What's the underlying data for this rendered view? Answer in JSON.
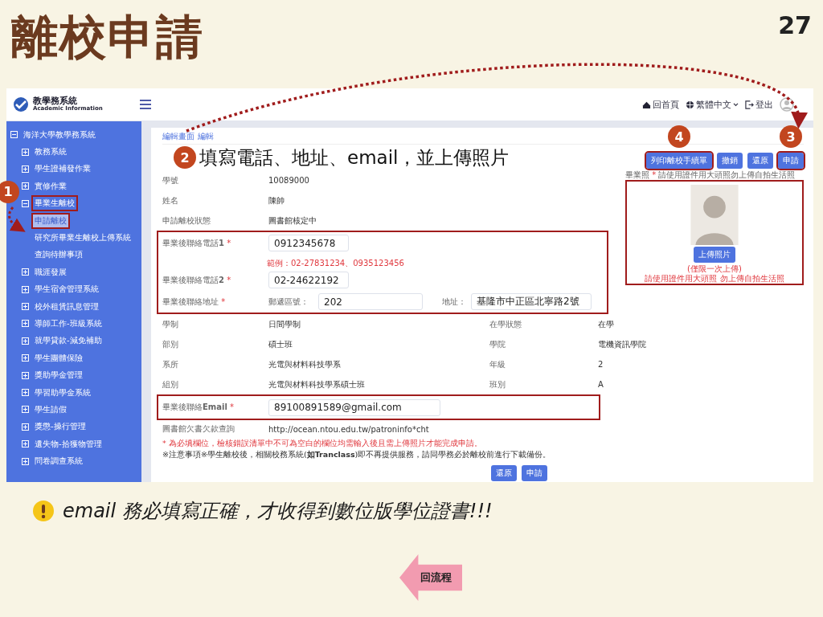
{
  "slide": {
    "title": "離校申請",
    "page_number": "27",
    "note": "email 務必填寫正確，才收得到數位版學位證書!!!",
    "back_button": "回流程"
  },
  "header": {
    "logo_title": "教學務系統",
    "logo_subtitle": "Academic Information",
    "links": [
      {
        "kind": "home",
        "label": "回首頁"
      },
      {
        "kind": "language",
        "label": "繁體中文"
      },
      {
        "kind": "logout",
        "label": "登出"
      }
    ]
  },
  "sidebar": {
    "items": [
      {
        "label": "海洋大學教學務系統",
        "expanded": true,
        "selected": false,
        "highlighted": false,
        "children": [
          {
            "label": "教務系統",
            "expanded": false,
            "selected": false,
            "highlighted": false
          },
          {
            "label": "學生證補發作業",
            "expanded": false,
            "selected": false,
            "highlighted": false
          },
          {
            "label": "實修作業",
            "expanded": false,
            "selected": false,
            "highlighted": false
          },
          {
            "label": "畢業生離校",
            "expanded": true,
            "selected": false,
            "highlighted": true,
            "step": "1",
            "children": [
              {
                "label": "申請離校",
                "selected": true,
                "highlighted": true
              },
              {
                "label": "研究所畢業生離校上傳系統",
                "selected": false,
                "highlighted": false
              },
              {
                "label": "查詢待辦事項",
                "selected": false,
                "highlighted": false
              }
            ]
          },
          {
            "label": "職涯發展",
            "expanded": false,
            "selected": false,
            "highlighted": false
          },
          {
            "label": "學生宿舍管理系統",
            "expanded": false,
            "selected": false,
            "highlighted": false
          },
          {
            "label": "校外租賃訊息管理",
            "expanded": false,
            "selected": false,
            "highlighted": false
          },
          {
            "label": "導師工作-班級系統",
            "expanded": false,
            "selected": false,
            "highlighted": false
          },
          {
            "label": "就學貸款-減免補助",
            "expanded": false,
            "selected": false,
            "highlighted": false
          },
          {
            "label": "學生團體保險",
            "expanded": false,
            "selected": false,
            "highlighted": false
          },
          {
            "label": "獎助學金管理",
            "expanded": false,
            "selected": false,
            "highlighted": false
          },
          {
            "label": "學習助學金系統",
            "expanded": false,
            "selected": false,
            "highlighted": false
          },
          {
            "label": "學生請假",
            "expanded": false,
            "selected": false,
            "highlighted": false
          },
          {
            "label": "獎懲-操行管理",
            "expanded": false,
            "selected": false,
            "highlighted": false
          },
          {
            "label": "遺失物-拾獲物管理",
            "expanded": false,
            "selected": false,
            "highlighted": false
          },
          {
            "label": "問卷調查系統",
            "expanded": false,
            "selected": false,
            "highlighted": false
          }
        ]
      }
    ]
  },
  "form": {
    "breadcrumb": [
      {
        "label": "編輯畫面"
      },
      {
        "label": "編輯"
      }
    ],
    "instruction": {
      "step": "2",
      "text": "填寫電話、地址、email，並上傳照片"
    },
    "actions": [
      {
        "label": "列印離校手續單",
        "highlighted": true,
        "step": "4"
      },
      {
        "label": "撤銷",
        "highlighted": false
      },
      {
        "label": "還原",
        "highlighted": false
      },
      {
        "label": "申請",
        "highlighted": true,
        "step": "3"
      }
    ],
    "info_rows": [
      {
        "label": "學號",
        "value": "10089000"
      },
      {
        "label": "姓名",
        "value": "陳帥"
      },
      {
        "label": "申請離校狀態",
        "value": "圖書館核定中"
      }
    ],
    "contact": {
      "highlighted": true,
      "fields": [
        {
          "kind": "input",
          "label": "畢業後聯絡電話**1**",
          "required_mark": "*",
          "value": "0912345678",
          "hint": "範例：02-27831234、0935123456"
        },
        {
          "kind": "input",
          "label": "畢業後聯絡電話**2**",
          "required_mark": "*",
          "value": "02-24622192"
        },
        {
          "kind": "address",
          "label": "畢業後聯絡地址",
          "required_mark": "*",
          "zip_label": "郵遞區號：",
          "zip": "202",
          "address_label": "地址：",
          "address": "基隆市中正區北寧路2號"
        }
      ]
    },
    "photo": {
      "label": "畢業照",
      "required_mark": "*",
      "note": "請使用證件用大頭照勿上傳自拍生活照",
      "highlighted": true,
      "upload_button": "上傳照片",
      "limit_note": "(僅限一次上傳)",
      "warning": "請使用證件用大頭照 勿上傳自拍生活照"
    },
    "detail_rows": [
      {
        "left": {
          "label": "學制",
          "value": "日間學制"
        },
        "right": {
          "label": "在學狀態",
          "value": "在學"
        }
      },
      {
        "left": {
          "label": "部別",
          "value": "碩士班"
        },
        "right": {
          "label": "學院",
          "value": "電機資訊學院"
        }
      },
      {
        "left": {
          "label": "系所",
          "value": "光電與材料科技學系"
        },
        "right": {
          "label": "年級",
          "value": "2"
        }
      },
      {
        "left": {
          "label": "組別",
          "value": "光電與材料科技學系碩士班"
        },
        "right": {
          "label": "班別",
          "value": "A"
        }
      }
    ],
    "email": {
      "highlighted": true,
      "label": "畢業後聯絡**Email**",
      "required_mark": "*",
      "value": "89100891589@gmail.com"
    },
    "library": {
      "label": "圖書館欠書欠款查詢",
      "value": "http://ocean.ntou.edu.tw/patroninfo*cht"
    },
    "notes": [
      {
        "kind": "required",
        "text": "* 為必填欄位，檢核錯誤清單中不可為空白的欄位均需輸入後且需上傳照片才能完成申請。"
      },
      {
        "kind": "notice",
        "text": "※注意事項※學生離校後，相關校務系統(**如Tranclass**)即不再提供服務，請同學務必於離校前進行下載備份。"
      }
    ],
    "footer_buttons": [
      {
        "label": "還原"
      },
      {
        "label": "申請"
      }
    ]
  }
}
